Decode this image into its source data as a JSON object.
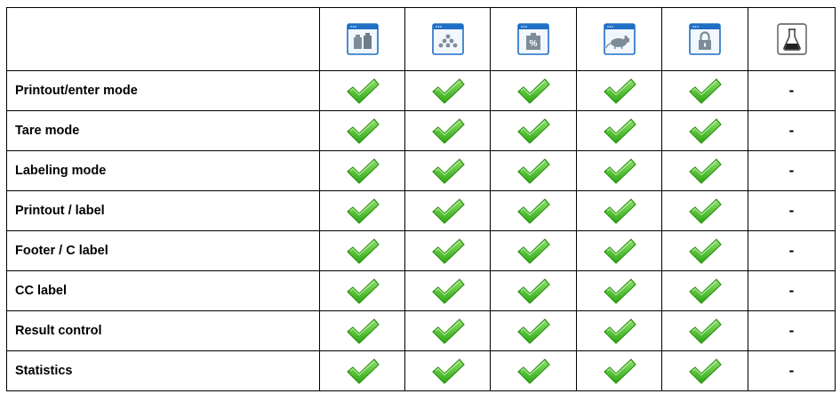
{
  "modes": [
    {
      "icon": "weighing-icon"
    },
    {
      "icon": "parts-counting-icon"
    },
    {
      "icon": "percent-weighing-icon"
    },
    {
      "icon": "animal-weighing-icon"
    },
    {
      "icon": "locked-mode-icon"
    },
    {
      "icon": "density-flask-icon"
    }
  ],
  "rows": [
    {
      "label": "Printout/enter mode",
      "dash": "-"
    },
    {
      "label": "Tare mode",
      "dash": "-"
    },
    {
      "label": "Labeling mode",
      "dash": "-"
    },
    {
      "label": "Printout / label",
      "dash": "-"
    },
    {
      "label": "Footer / C label",
      "dash": "-"
    },
    {
      "label": "CC label",
      "dash": "-"
    },
    {
      "label": "Result control",
      "dash": "-"
    },
    {
      "label": "Statistics",
      "dash": "-"
    }
  ],
  "colors": {
    "icon_blue": "#1f6fc5",
    "icon_bg": "#eef5fc",
    "check_green": "#3fbf1f",
    "check_outline": "#2b8f12"
  }
}
